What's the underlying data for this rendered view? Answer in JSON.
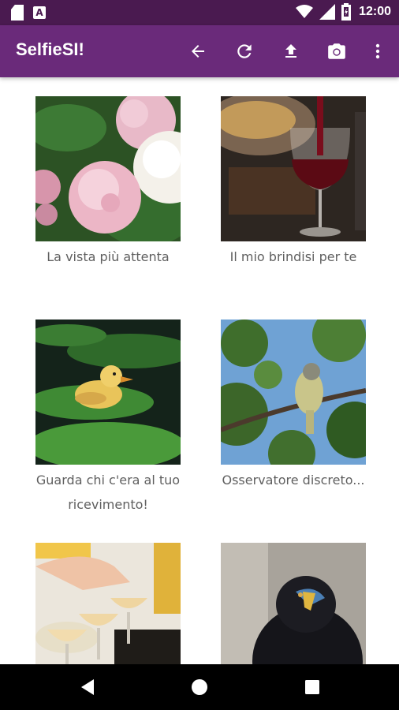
{
  "status_bar": {
    "time": "12:00"
  },
  "app_bar": {
    "title": "SelfieSI!",
    "actions": [
      "back-arrow-icon",
      "refresh-icon",
      "upload-icon",
      "camera-icon",
      "more-vert-icon"
    ]
  },
  "gallery": {
    "items": [
      {
        "caption": "La vista più attenta",
        "image": "pink and white peonies"
      },
      {
        "caption": "Il mio brindisi per te",
        "image": "red wine poured into glass"
      },
      {
        "caption": "Guarda chi c'era al tuo ricevimento!",
        "image": "duckling on lily pad"
      },
      {
        "caption": "Osservatore discreto...",
        "image": "small bird on branch"
      },
      {
        "caption": "",
        "image": "cocktails being garnished"
      },
      {
        "caption": "",
        "image": "black eagle portrait"
      }
    ]
  },
  "colors": {
    "status_bar": "#4a1a50",
    "app_bar": "#6a2a7a",
    "caption_text": "#5f5f5f"
  }
}
